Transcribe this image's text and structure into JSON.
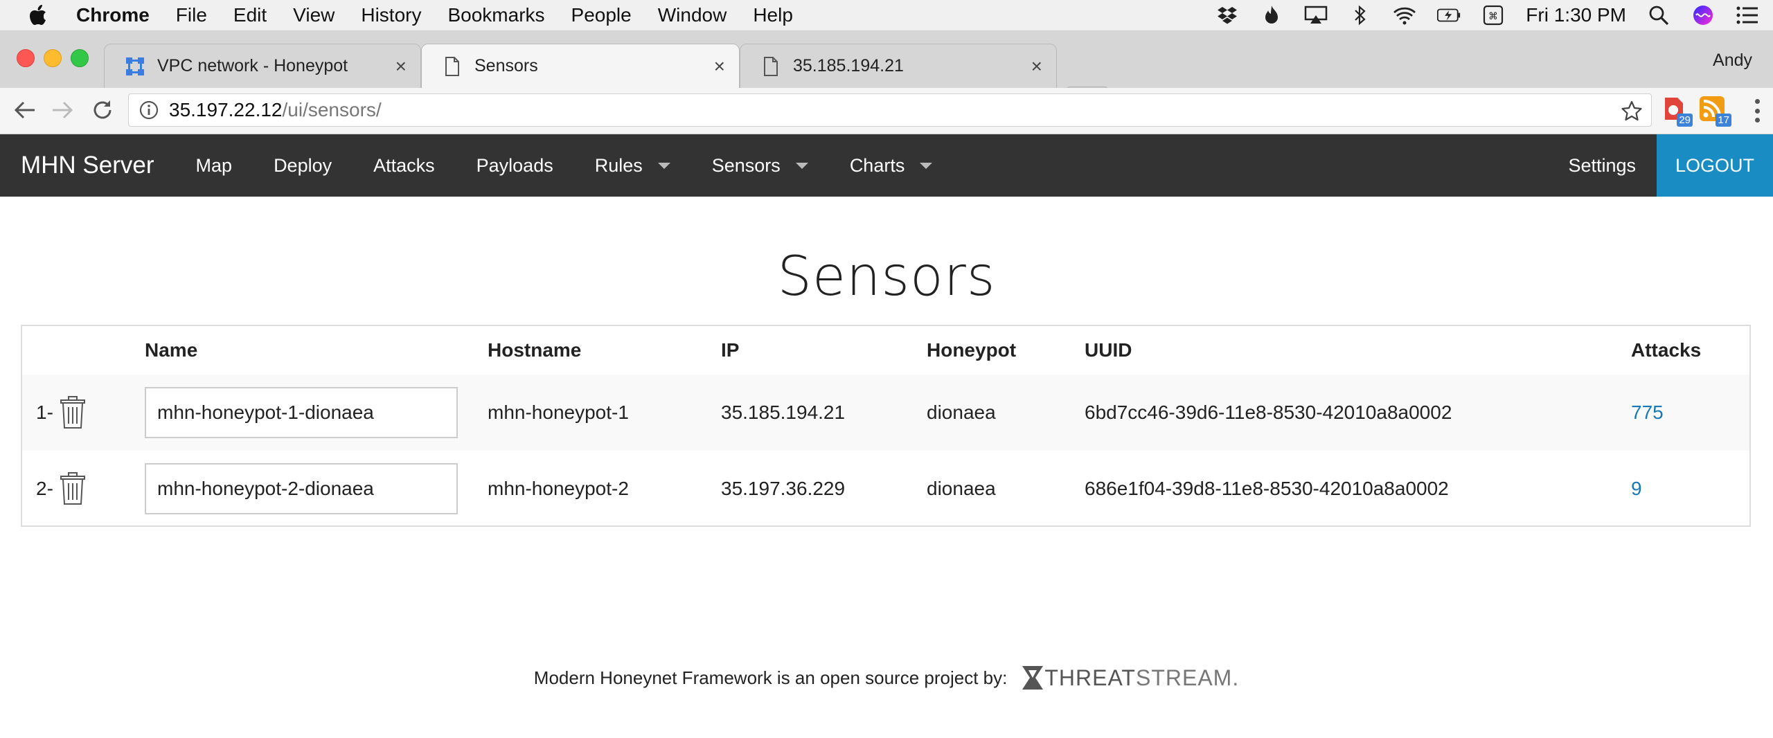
{
  "menubar": {
    "app_name": "Chrome",
    "items": [
      "File",
      "Edit",
      "View",
      "History",
      "Bookmarks",
      "People",
      "Window",
      "Help"
    ],
    "clock": "Fri 1:30 PM"
  },
  "tabs": [
    {
      "title": "VPC network - Honeypot",
      "icon": "gcp-network-icon",
      "close": "×"
    },
    {
      "title": "Sensors",
      "icon": "page-icon",
      "close": "×"
    },
    {
      "title": "35.185.194.21",
      "icon": "page-icon",
      "close": "×"
    }
  ],
  "profile_name": "Andy",
  "address_bar": {
    "host": "35.197.22.12",
    "path": "/ui/sensors/"
  },
  "extensions": [
    {
      "icon": "red-extension-icon",
      "badge": "29"
    },
    {
      "icon": "rss-extension-icon",
      "badge": "17"
    }
  ],
  "nav": {
    "brand": "MHN Server",
    "links": [
      {
        "label": "Map"
      },
      {
        "label": "Deploy"
      },
      {
        "label": "Attacks"
      },
      {
        "label": "Payloads"
      },
      {
        "label": "Rules"
      },
      {
        "label": "Sensors"
      },
      {
        "label": "Charts"
      }
    ],
    "settings": "Settings",
    "logout": "LOGOUT"
  },
  "page": {
    "title": "Sensors"
  },
  "table": {
    "headers": [
      "",
      "Name",
      "Hostname",
      "IP",
      "Honeypot",
      "UUID",
      "Attacks"
    ],
    "rows": [
      {
        "num": "1-",
        "name": "mhn-honeypot-1-dionaea",
        "hostname": "mhn-honeypot-1",
        "ip": "35.185.194.21",
        "honeypot": "dionaea",
        "uuid": "6bd7cc46-39d6-11e8-8530-42010a8a0002",
        "attacks": "775"
      },
      {
        "num": "2-",
        "name": "mhn-honeypot-2-dionaea",
        "hostname": "mhn-honeypot-2",
        "ip": "35.197.36.229",
        "honeypot": "dionaea",
        "uuid": "686e1f04-39d8-11e8-8530-42010a8a0002",
        "attacks": "9"
      }
    ]
  },
  "footer": {
    "text": "Modern Honeynet Framework is an open source project by:",
    "logo_bold": "THREAT",
    "logo_thin": "STREAM."
  },
  "colors": {
    "nav_bg": "#333333",
    "logout_bg": "#1a8cc4",
    "link": "#1a78b5"
  }
}
